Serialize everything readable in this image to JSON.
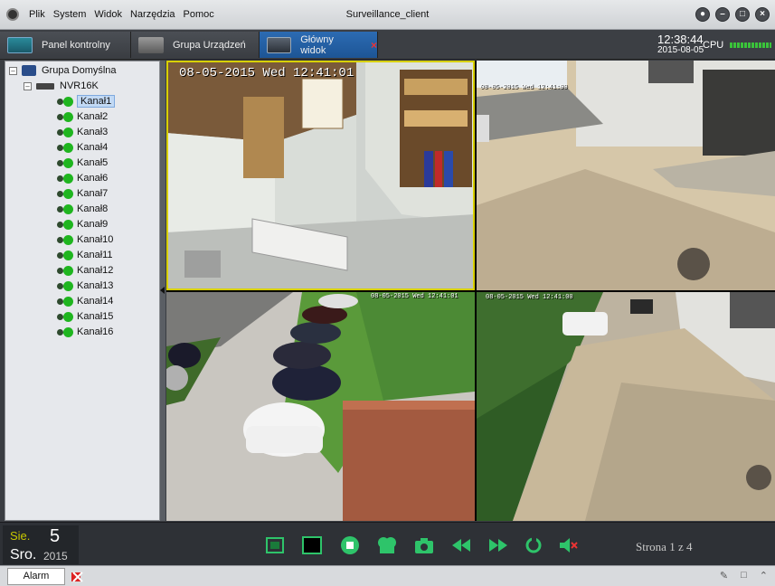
{
  "menu": [
    "Plik",
    "System",
    "Widok",
    "Narzędzia",
    "Pomoc"
  ],
  "window_title": "Surveillance_client",
  "tabs": [
    {
      "label": "Panel kontrolny",
      "icon": "monitor-panel-icon"
    },
    {
      "label": "Grupa Urządzeń",
      "icon": "device-group-icon"
    },
    {
      "label": "Główny widok",
      "icon": "main-view-icon",
      "active": true
    }
  ],
  "clock": {
    "time": "12:38:44",
    "date": "2015-08-05",
    "cpu_label": "CPU"
  },
  "tree": {
    "root": "Grupa Domyślna",
    "device": "NVR16K",
    "channels": [
      "Kanał1",
      "Kanał2",
      "Kanał3",
      "Kanał4",
      "Kanał5",
      "Kanał6",
      "Kanał7",
      "Kanał8",
      "Kanał9",
      "Kanał10",
      "Kanał11",
      "Kanał12",
      "Kanał13",
      "Kanał14",
      "Kanał15",
      "Kanał16"
    ],
    "selected_channel": "Kanał1"
  },
  "video": {
    "cam1_osd": "08-05-2015 Wed 12:41:01",
    "cam2_osd": "08-05-2015 Wed 12:41:00",
    "cam3_osd": "08-05-2015 Wed 12:41:01",
    "cam4_osd": "08-05-2015 Wed 12:41:00"
  },
  "datebox": {
    "month": "Sie.",
    "day": "5",
    "weekday": "Sro.",
    "year": "2015"
  },
  "toolbar_icons": [
    "fullscreen-icon",
    "single-view-icon",
    "stop-icon",
    "record-icon",
    "snapshot-icon",
    "rewind-icon",
    "forward-icon",
    "refresh-icon",
    "mute-icon"
  ],
  "page_info": "Strona 1 z 4",
  "status": {
    "alarm_tab": "Alarm"
  },
  "colors": {
    "accent_tab": "#2c6bb3",
    "selection_outline": "#d8d000",
    "cpu_meter": "#3ac43a",
    "toolbar_icon": "#2ec46a"
  }
}
